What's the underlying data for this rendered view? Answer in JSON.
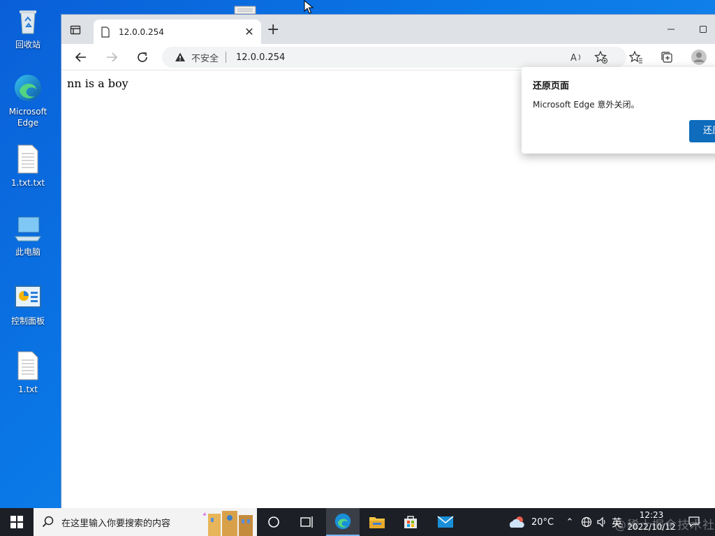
{
  "desktop": {
    "icons": [
      {
        "label": "回收站",
        "icon": "recycle-bin-icon"
      },
      {
        "label": "Microsoft\nEdge",
        "icon": "edge-icon"
      },
      {
        "label": "1.txt.txt",
        "icon": "text-file-icon"
      },
      {
        "label": "此电脑",
        "icon": "computer-icon"
      },
      {
        "label": "控制面板",
        "icon": "control-panel-icon"
      },
      {
        "label": "1.txt",
        "icon": "text-file-icon"
      }
    ]
  },
  "browser": {
    "tab_title": "12.0.0.254",
    "address": {
      "security_label": "不安全",
      "url": "12.0.0.254"
    },
    "page_text": "nn is a boy",
    "restore_popup": {
      "title": "还原页面",
      "message": "Microsoft Edge 意外关闭。",
      "button": "还原"
    }
  },
  "taskbar": {
    "search_placeholder": "在这里输入你要搜索的内容",
    "weather": "20°C",
    "ime": "英",
    "time": "12:23",
    "date": "2022/10/12",
    "watermark": "@稀土掘金技术社区"
  },
  "colors": {
    "desktop_blue": "#0a78e6",
    "edge_accent": "#0f6cbd",
    "taskbar": "#1c1f26"
  }
}
